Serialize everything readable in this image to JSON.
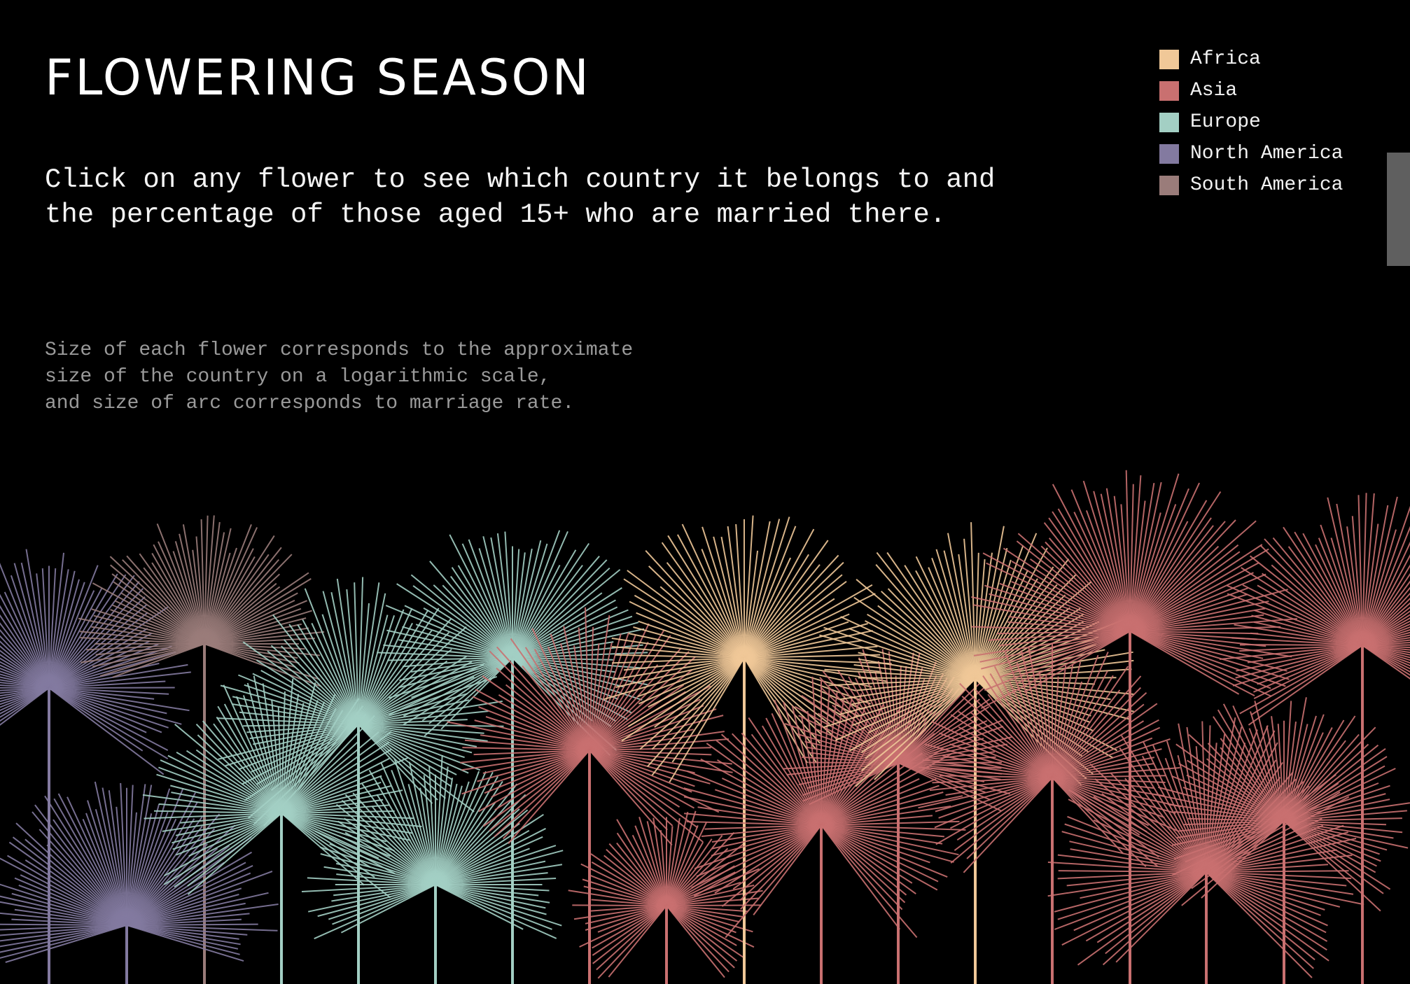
{
  "header": {
    "title": "FLOWERING SEASON",
    "instruction_line1": "Click on any flower to see which country it belongs to and",
    "instruction_line2": "the percentage of those aged 15+ who are married there.",
    "note_line1": "Size of each flower corresponds to the approximate",
    "note_line2": "size of the country on a logarithmic scale,",
    "note_line3": "and size of arc corresponds to marriage rate."
  },
  "legend": [
    {
      "label": "Africa",
      "color": "#f0c898"
    },
    {
      "label": "Asia",
      "color": "#c97070"
    },
    {
      "label": "Europe",
      "color": "#a3cfc4"
    },
    {
      "label": "North America",
      "color": "#837aa0"
    },
    {
      "label": "South America",
      "color": "#9a7c7a"
    }
  ],
  "chart_data": {
    "type": "radial-flower",
    "flowers": [
      {
        "region": "North America",
        "size_level": 0.55,
        "arc_level": 0.62
      },
      {
        "region": "South America",
        "size_level": 0.46,
        "arc_level": 0.45
      },
      {
        "region": "North America",
        "size_level": 0.62,
        "arc_level": 0.42
      },
      {
        "region": "Europe",
        "size_level": 0.53,
        "arc_level": 0.66
      },
      {
        "region": "Europe",
        "size_level": 0.57,
        "arc_level": 0.72
      },
      {
        "region": "Europe",
        "size_level": 0.52,
        "arc_level": 0.7
      },
      {
        "region": "Europe",
        "size_level": 0.49,
        "arc_level": 0.52
      },
      {
        "region": "Asia",
        "size_level": 0.56,
        "arc_level": 0.74
      },
      {
        "region": "Asia",
        "size_level": 0.28,
        "arc_level": 0.76
      },
      {
        "region": "Africa",
        "size_level": 0.58,
        "arc_level": 0.84
      },
      {
        "region": "Asia",
        "size_level": 0.58,
        "arc_level": 0.78
      },
      {
        "region": "Asia",
        "size_level": 0.4,
        "arc_level": 0.5
      },
      {
        "region": "Africa",
        "size_level": 0.66,
        "arc_level": 0.7
      },
      {
        "region": "Asia",
        "size_level": 0.51,
        "arc_level": 0.72
      },
      {
        "region": "Asia",
        "size_level": 0.7,
        "arc_level": 0.55
      },
      {
        "region": "Asia",
        "size_level": 0.66,
        "arc_level": 0.7
      },
      {
        "region": "Asia",
        "size_level": 0.48,
        "arc_level": 0.68
      },
      {
        "region": "Asia",
        "size_level": 0.6,
        "arc_level": 0.6
      }
    ]
  }
}
